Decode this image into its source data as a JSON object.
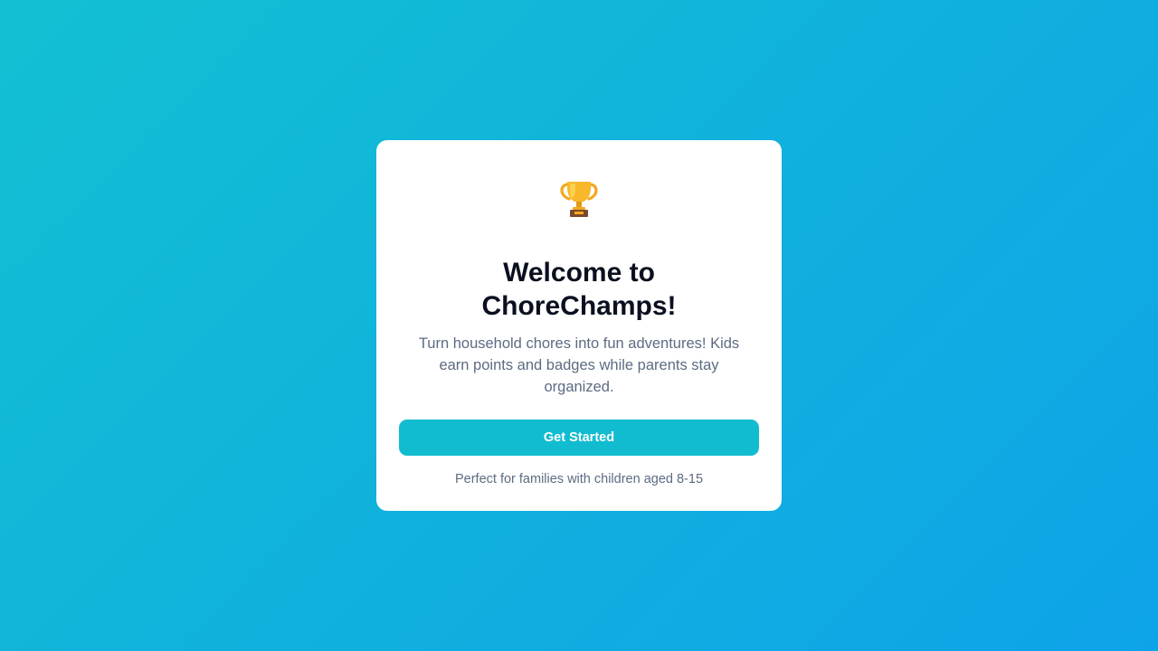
{
  "welcome": {
    "icon": "trophy-icon",
    "title": "Welcome to ChoreChamps!",
    "description": "Turn household chores into fun adventures! Kids earn points and badges while parents stay organized.",
    "cta_label": "Get Started",
    "footnote": "Perfect for families with children aged 8-15"
  },
  "colors": {
    "background_start": "#12c0d2",
    "background_end": "#0ea3e8",
    "button": "#12bcd0",
    "title_text": "#0b1020",
    "muted_text": "#5c6b82"
  }
}
